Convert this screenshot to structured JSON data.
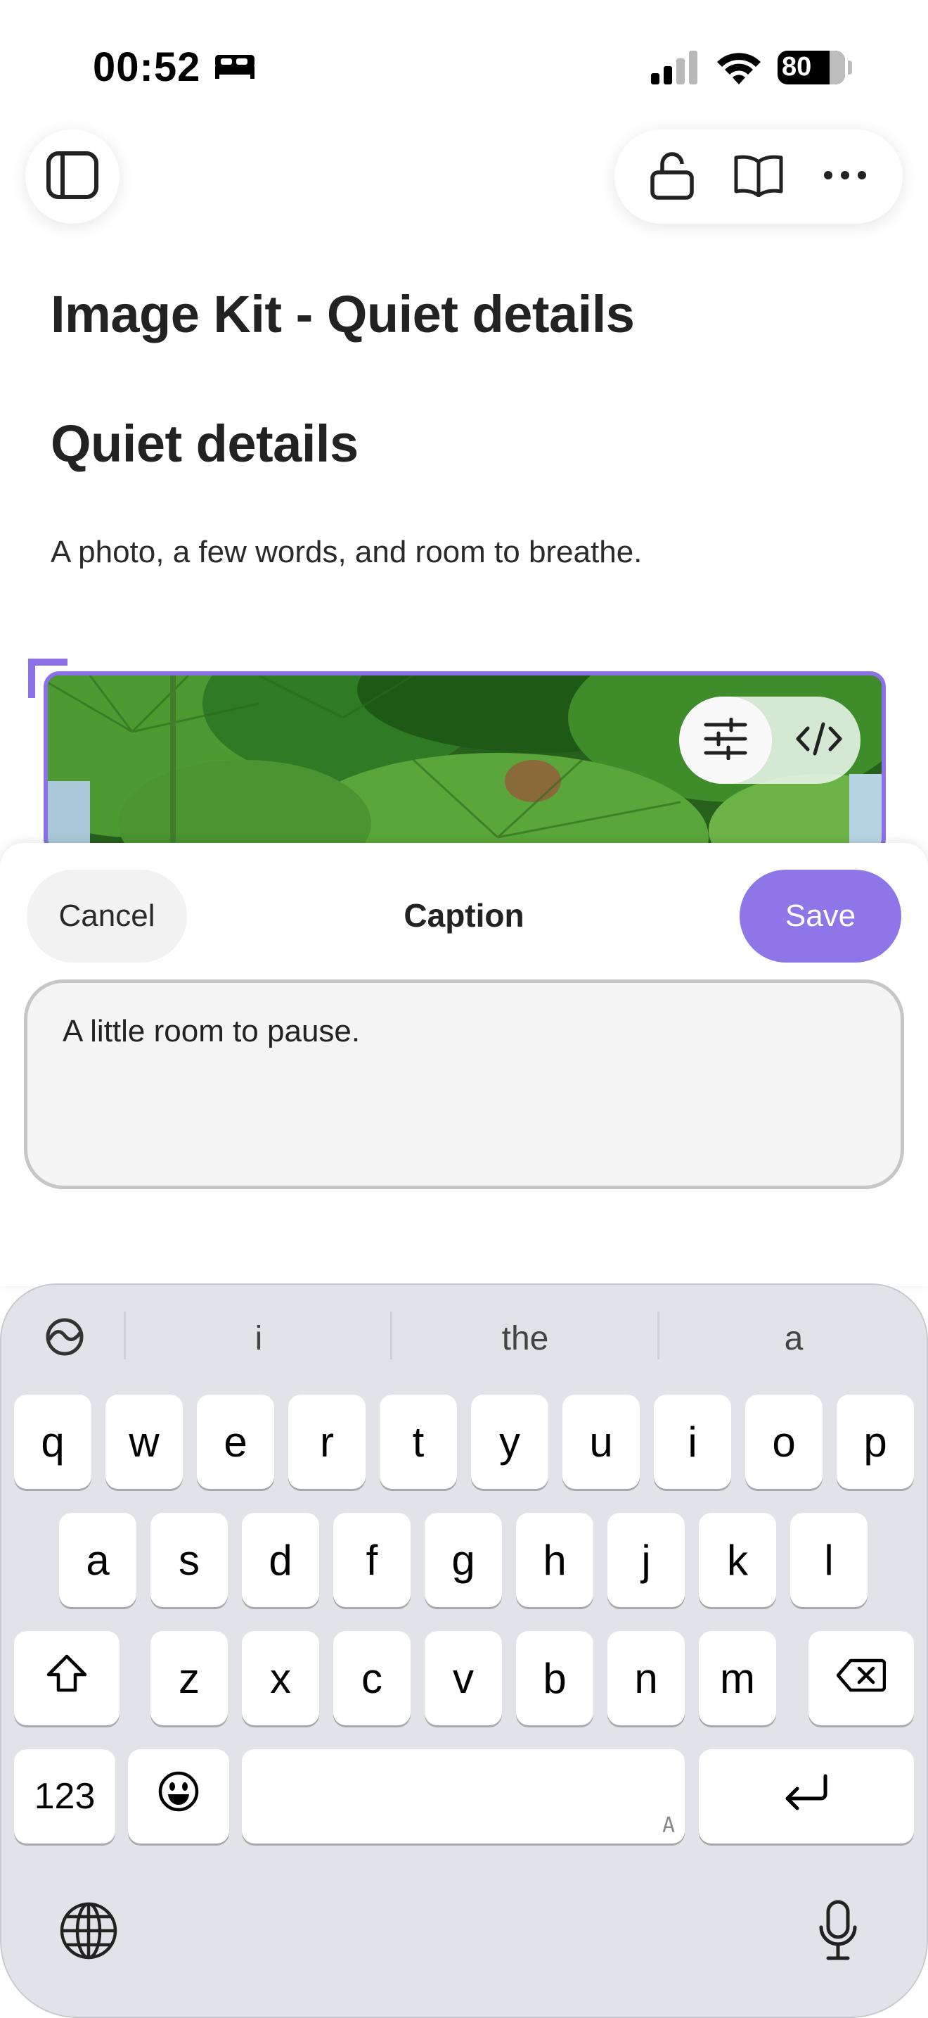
{
  "status_bar": {
    "time": "00:52",
    "battery": "80",
    "icons": [
      "bed-icon",
      "cellular-signal-icon",
      "wifi-icon",
      "battery-charging-icon"
    ]
  },
  "toolbar": {
    "left_icon": "sidebar-icon",
    "right_icons": [
      "unlock-icon",
      "book-icon",
      "more-icon"
    ]
  },
  "document": {
    "title": "Image Kit - Quiet details",
    "heading": "Quiet details",
    "paragraph": "A photo, a few words, and room to breathe."
  },
  "image_block": {
    "accent_color": "#8b70e6",
    "tools": [
      "adjust-sliders-icon",
      "code-icon"
    ]
  },
  "caption_sheet": {
    "cancel_label": "Cancel",
    "title": "Caption",
    "save_label": "Save",
    "save_color": "#8e76e8",
    "input_value": "A little room to pause."
  },
  "keyboard": {
    "suggestions": [
      "i",
      "the",
      "a"
    ],
    "row1": [
      "q",
      "w",
      "e",
      "r",
      "t",
      "y",
      "u",
      "i",
      "o",
      "p"
    ],
    "row2": [
      "a",
      "s",
      "d",
      "f",
      "g",
      "h",
      "j",
      "k",
      "l"
    ],
    "row3": [
      "z",
      "x",
      "c",
      "v",
      "b",
      "n",
      "m"
    ],
    "numbers_label": "123",
    "space_hint": "A",
    "icons": [
      "emoji-toggle-icon",
      "shift-icon",
      "delete-icon",
      "emoji-icon",
      "return-icon",
      "globe-icon",
      "microphone-icon"
    ]
  }
}
